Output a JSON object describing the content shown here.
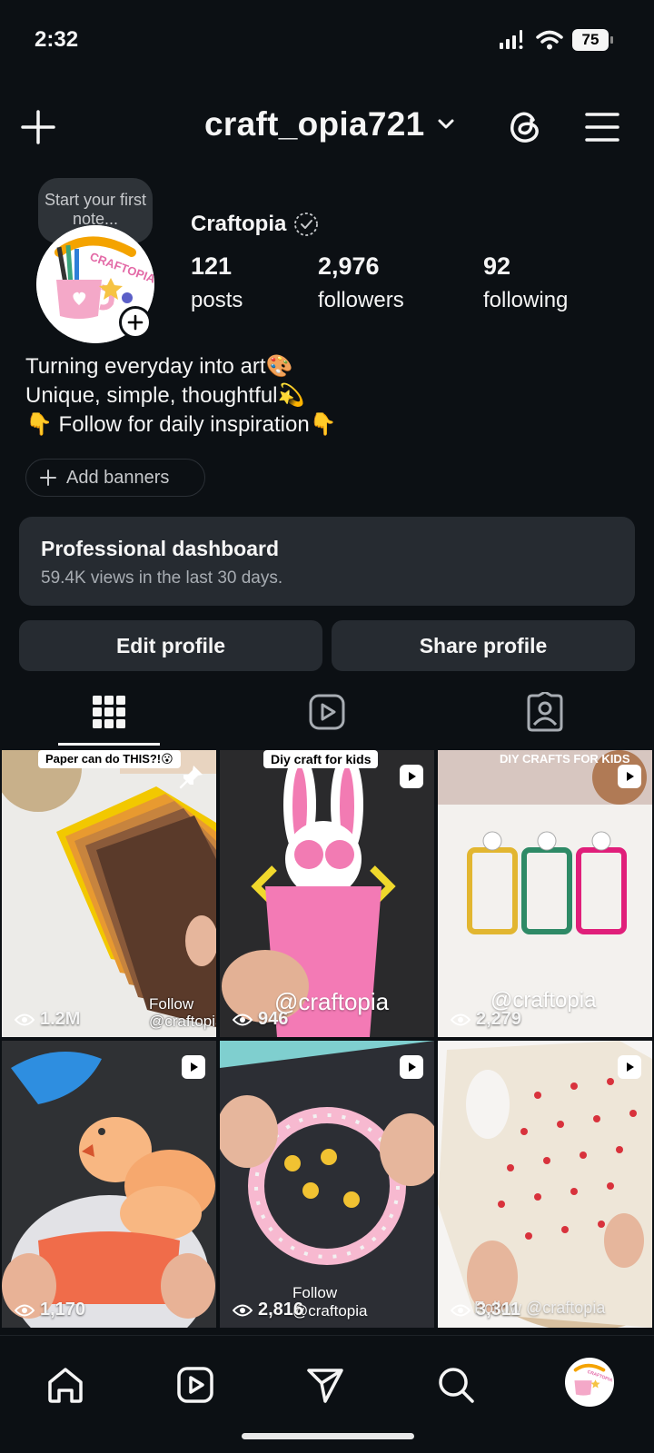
{
  "status": {
    "time": "2:32",
    "battery": "75"
  },
  "header": {
    "username": "craft_opia721",
    "icons": [
      "plus-icon",
      "chevron-down-icon",
      "threads-icon",
      "menu-icon"
    ]
  },
  "note": {
    "text": "Start your first note..."
  },
  "profile": {
    "display_name": "Craftopia",
    "avatar_text": "CRAFTOPIA",
    "stats": [
      {
        "value": "121",
        "label": "posts"
      },
      {
        "value": "2,976",
        "label": "followers"
      },
      {
        "value": "92",
        "label": "following"
      }
    ],
    "bio": [
      "Turning everyday into art🎨",
      "Unique, simple, thoughtful💫",
      "👇 Follow for daily inspiration👇"
    ],
    "add_banners": "Add banners"
  },
  "dashboard": {
    "title": "Professional dashboard",
    "subtitle": "59.4K views in the last 30 days."
  },
  "buttons": {
    "edit": "Edit profile",
    "share": "Share profile"
  },
  "tabs": [
    "grid-icon",
    "reels-icon",
    "tagged-icon"
  ],
  "posts": [
    {
      "views": "1.2M",
      "top_text": "Paper can do THIS?!😮",
      "overlay": "Follow\n@craftopia",
      "pinned": true
    },
    {
      "views": "946",
      "top_text": "Diy craft for kids",
      "overlay": "@craftopia"
    },
    {
      "views": "2,279",
      "top_text": "DIY CRAFTS FOR KIDS",
      "overlay": "@craftopia"
    },
    {
      "views": "1,170"
    },
    {
      "views": "2,816",
      "overlay": "Follow\n@craftopia"
    },
    {
      "views": "3,311",
      "overlay": "Follow @craftopia"
    }
  ],
  "colors": {
    "bg": "#0c1014",
    "card": "#262b31",
    "text": "#f5f5f5",
    "muted": "#a8adb3"
  }
}
